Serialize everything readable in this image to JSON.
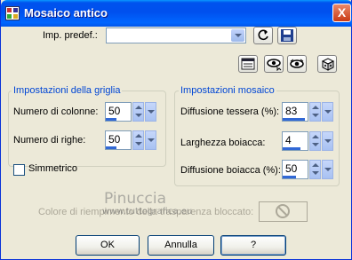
{
  "window": {
    "title": "Mosaico antico",
    "close_glyph": "X",
    "icon": "app-mosaic-icon"
  },
  "preset": {
    "label": "Imp. predef.:",
    "value": ""
  },
  "grid_group": {
    "title": "Impostazioni della griglia",
    "columns": {
      "label": "Numero di colonne:",
      "value": "50",
      "level": 0.4
    },
    "rows": {
      "label": "Numero di righe:",
      "value": "50",
      "level": 0.4
    },
    "symmetric": {
      "label": "Simmetrico",
      "checked": false
    }
  },
  "mosaic_group": {
    "title": "Impostazioni mosaico",
    "tile_diffusion": {
      "label": "Diffusione tessera (%):",
      "value": "83",
      "level": 0.83
    },
    "grout_width": {
      "label": "Larghezza boiacca:",
      "value": "4",
      "level": 0.4
    },
    "grout_diffusion": {
      "label": "Diffusione boiacca (%):",
      "value": "50",
      "level": 0.5
    }
  },
  "grout_color": {
    "label": "Colore di riempimento della trasparenza bloccato:"
  },
  "watermark": {
    "line1": "Pinuccia",
    "line2": "www.tuttografica.eu"
  },
  "buttons": {
    "ok": "OK",
    "cancel": "Annulla",
    "help": "?"
  },
  "icons": [
    "reset-icon",
    "save-preset-icon",
    "proof-window-icon",
    "eye-auto-proof-icon",
    "eye-proof-icon",
    "randomize-dice-icon",
    "no-color-icon"
  ]
}
